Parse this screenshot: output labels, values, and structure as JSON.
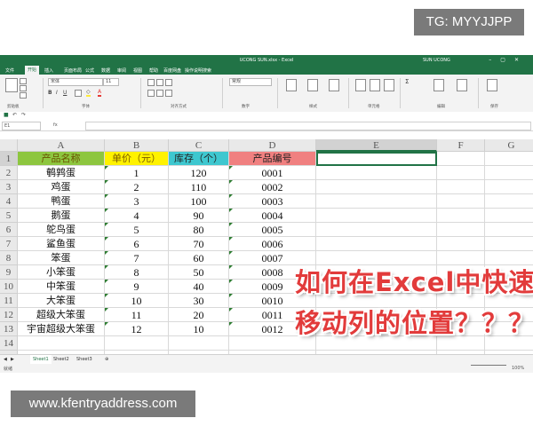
{
  "overlays": {
    "top_right_tag": "TG: MYYJJPP",
    "bottom_watermark": "www.kfentryaddress.com",
    "headline_line1": "如何在Excel中快速",
    "headline_line2": "移动列的位置？？？"
  },
  "window": {
    "title": "UCONG SUN.xlsx - Excel",
    "user": "SUN UCONG",
    "accent_color": "#217346"
  },
  "ribbon_tabs": [
    "文件",
    "开始",
    "插入",
    "页面布局",
    "公式",
    "数据",
    "审阅",
    "视图",
    "帮助",
    "百度网盘",
    "操作说明搜索"
  ],
  "active_tab": "开始",
  "ribbon": {
    "font_name": "宋体",
    "font_size": "11",
    "number_format": "常规",
    "groups": [
      "剪贴板",
      "字体",
      "对齐方式",
      "数字",
      "样式",
      "单元格",
      "编辑",
      "保存"
    ]
  },
  "formula_bar": {
    "name_box": "E1",
    "fx_label": "fx",
    "content": ""
  },
  "columns": [
    "A",
    "B",
    "C",
    "D",
    "E",
    "F",
    "G"
  ],
  "row_numbers": [
    "1",
    "2",
    "3",
    "4",
    "5",
    "6",
    "7",
    "8",
    "9",
    "10",
    "11",
    "12",
    "13",
    "14",
    "15"
  ],
  "header_row": [
    "产品名称",
    "单价（元）",
    "库存（个）",
    "产品编号"
  ],
  "header_colors": [
    "#8dc63f",
    "#fff200",
    "#3ec7cf",
    "#f08080"
  ],
  "rows": [
    [
      "鹌鹑蛋",
      "1",
      "120",
      "0001"
    ],
    [
      "鸡蛋",
      "2",
      "110",
      "0002"
    ],
    [
      "鸭蛋",
      "3",
      "100",
      "0003"
    ],
    [
      "鹅蛋",
      "4",
      "90",
      "0004"
    ],
    [
      "鸵鸟蛋",
      "5",
      "80",
      "0005"
    ],
    [
      "鲨鱼蛋",
      "6",
      "70",
      "0006"
    ],
    [
      "笨蛋",
      "7",
      "60",
      "0007"
    ],
    [
      "小笨蛋",
      "8",
      "50",
      "0008"
    ],
    [
      "中笨蛋",
      "9",
      "40",
      "0009"
    ],
    [
      "大笨蛋",
      "10",
      "30",
      "0010"
    ],
    [
      "超级大笨蛋",
      "11",
      "20",
      "0011"
    ],
    [
      "宇宙超级大笨蛋",
      "12",
      "10",
      "0012"
    ]
  ],
  "sheets": [
    "Sheet1",
    "Sheet2",
    "Sheet3"
  ],
  "active_sheet": "Sheet1",
  "status": {
    "left": "就绪",
    "zoom": "100%"
  }
}
